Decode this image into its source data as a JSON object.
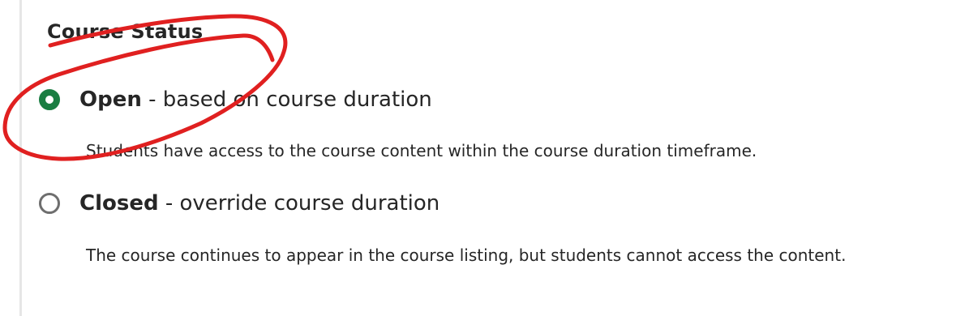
{
  "section": {
    "title": "Course Status"
  },
  "options": [
    {
      "name": "Open",
      "suffix": " - based on course duration",
      "description": "Students have access to the course content within the course duration timeframe.",
      "selected": true
    },
    {
      "name": "Closed",
      "suffix": " - override course duration",
      "description": "The course continues to appear in the course listing, but students cannot access the content.",
      "selected": false
    }
  ],
  "colors": {
    "radio_selected": "#1a7d42",
    "radio_unselected": "#6e6e6e",
    "annotation_stroke": "#e02020"
  },
  "icons": {
    "annotation": "red-hand-drawn-circle"
  }
}
